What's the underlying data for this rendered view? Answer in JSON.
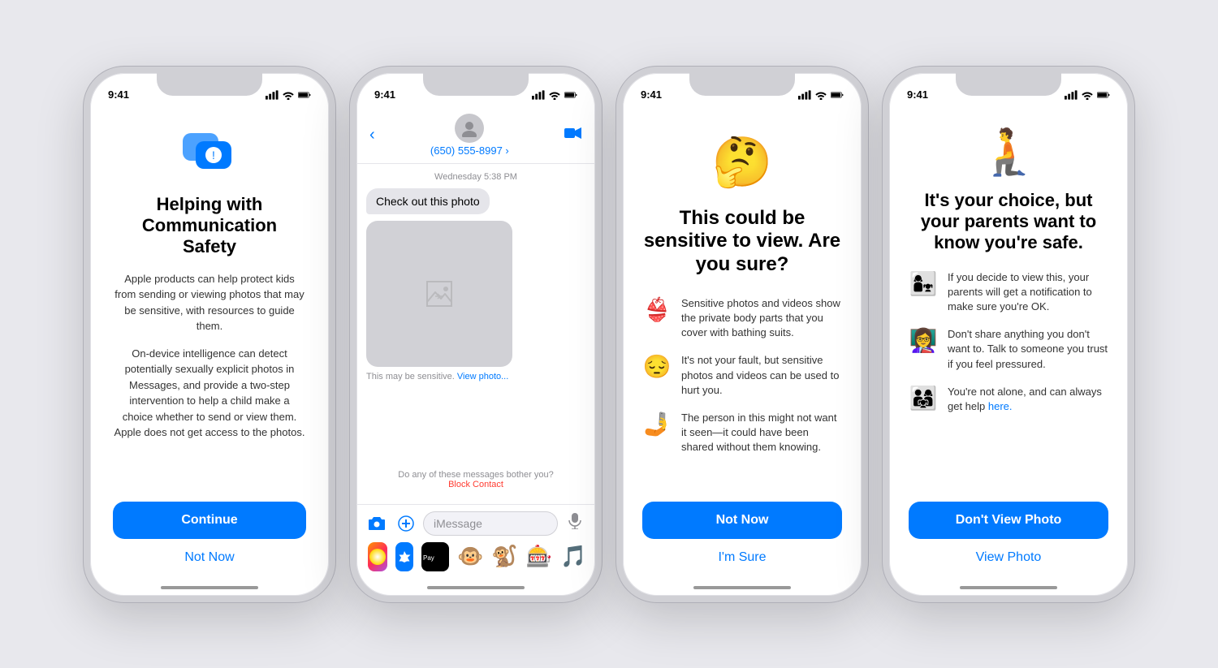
{
  "background_color": "#e8e8ed",
  "phones": [
    {
      "id": "phone1",
      "status_time": "9:41",
      "icon": "💬❗",
      "title": "Helping with Communication Safety",
      "desc1": "Apple products can help protect kids from sending or viewing photos that may be sensitive, with resources to guide them.",
      "desc2": "On-device intelligence can detect potentially sexually explicit photos in Messages, and provide a two-step intervention to help a child make a choice whether to send or view them. Apple does not get access to the photos.",
      "continue_label": "Continue",
      "not_now_label": "Not Now"
    },
    {
      "id": "phone2",
      "status_time": "9:41",
      "contact_number": "(650) 555-8997 ›",
      "msg_date": "Wednesday 5:38 PM",
      "msg_text": "Check out this photo",
      "sensitive_text": "This may be sensitive.",
      "view_photo_link": "View photo...",
      "block_prompt": "Do any of these messages bother you?",
      "block_link": "Block Contact",
      "input_placeholder": "iMessage"
    },
    {
      "id": "phone3",
      "status_time": "9:41",
      "emoji": "🤔",
      "title": "This could be sensitive to view. Are you sure?",
      "items": [
        {
          "emoji": "👙",
          "text": "Sensitive photos and videos show the private body parts that you cover with bathing suits."
        },
        {
          "emoji": "😔",
          "text": "It's not your fault, but sensitive photos and videos can be used to hurt you."
        },
        {
          "emoji": "🤳",
          "text": "The person in this might not want it seen—it could have been shared without them knowing."
        }
      ],
      "not_now_label": "Not Now",
      "im_sure_label": "I'm Sure"
    },
    {
      "id": "phone4",
      "status_time": "9:41",
      "emoji": "🧎",
      "title": "It's your choice, but your parents want to know you're safe.",
      "items": [
        {
          "emoji": "👩‍👧",
          "text": "If you decide to view this, your parents will get a notification to make sure you're OK."
        },
        {
          "emoji": "👩‍🏫",
          "text": "Don't share anything you don't want to. Talk to someone you trust if you feel pressured."
        },
        {
          "emoji": "👨‍👩‍👧",
          "text": "You're not alone, and can always get help here."
        }
      ],
      "dont_view_label": "Don't View Photo",
      "view_photo_label": "View Photo"
    }
  ]
}
